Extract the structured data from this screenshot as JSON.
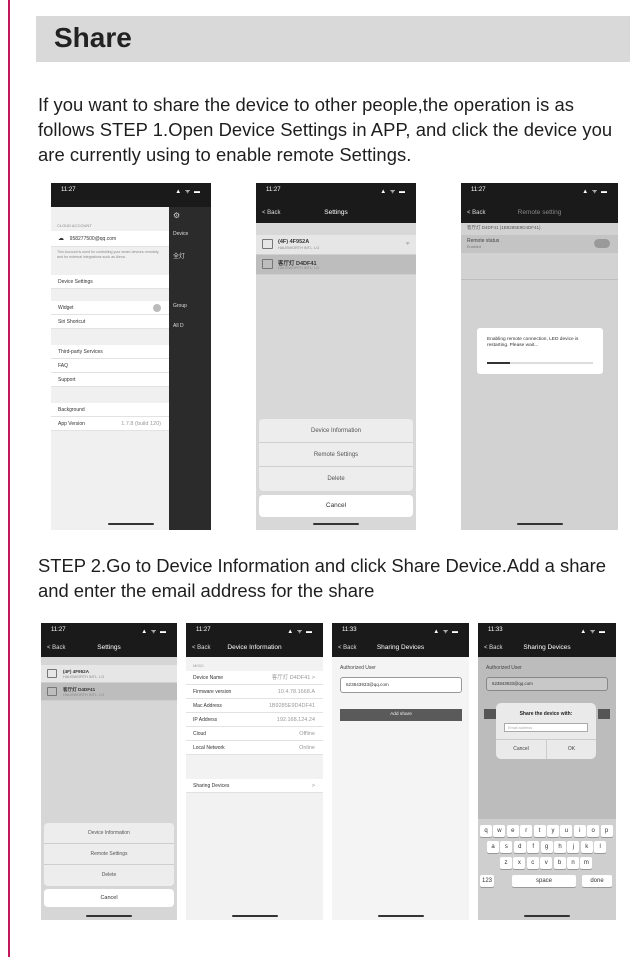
{
  "page": {
    "title": "Share",
    "intro": "If you want to share the device to other people,the operation is as follows STEP 1.Open Device Settings in APP, and click the device you are currently using to enable remote Settings.",
    "step2": "STEP 2.Go to Device Information and click Share Device.Add a share and enter the email address for the share"
  },
  "status_time": "11:27",
  "status_time_b": "11:33",
  "status_icons": "▲ ᯤ ▬",
  "phone1": {
    "account_label": "CLOUD ACCOUNT",
    "email": "958277500@qq.com",
    "note": "This Account is used for controlling your smart devices remotely, and for external integrations such as Alexa.",
    "device_settings": "Device Settings",
    "widget": "Widget",
    "siri": "Siri Shortcut",
    "third_party": "Third-party Services",
    "faq": "FAQ",
    "support": "Support",
    "background": "Background",
    "app_version_label": "App Version",
    "app_version_value": "1.7.8 (build 120)",
    "side_device": "Device",
    "side_group": "Group",
    "side_all": "All D",
    "side_item": "全灯"
  },
  "settings_screen": {
    "title": "Settings",
    "back": "< Back",
    "device1_name": "(4F) 4F952A",
    "device1_sub": "HAUSWORTH INTL. LG",
    "device2_name": "客厅灯 D4DF41",
    "device2_sub": "HAUSWORTH INTL. LG",
    "sheet_device_info": "Device Information",
    "sheet_remote": "Remote Settings",
    "sheet_delete": "Delete",
    "cancel": "Cancel"
  },
  "phone3": {
    "title": "Remote setting",
    "header_device": "客厅灯 D4DF41 (1B9285E9D4DF41)",
    "remote_label": "Remote status",
    "remote_sub": "Enabled",
    "dialog": "Enabling remote connection, LED device is restarting. Please wait..."
  },
  "device_info": {
    "title": "Device Information",
    "back": "< Back",
    "section": "MIGO",
    "rows": [
      {
        "label": "Device Name",
        "value": "客厅灯 D4DF41 >"
      },
      {
        "label": "Firmware version",
        "value": "10.4.78.1668.A"
      },
      {
        "label": "Mac Address",
        "value": "1B9285E9D4DF41"
      },
      {
        "label": "IP Address",
        "value": "192.168.124.24"
      },
      {
        "label": "Cloud",
        "value": "Offline"
      },
      {
        "label": "Local Network",
        "value": "Online"
      }
    ],
    "sharing": "Sharing Devices",
    "sharing_arrow": ">"
  },
  "sharing": {
    "title": "Sharing Devices",
    "back": "< Back",
    "authorized": "Authorized User",
    "user_email": "623843933@qq.com",
    "add_share": "Add share"
  },
  "share_dialog": {
    "title": "Share the device with:",
    "placeholder": "Email address",
    "cancel": "Cancel",
    "ok": "OK",
    "keys_row1": [
      "q",
      "w",
      "e",
      "r",
      "t",
      "y",
      "u",
      "i",
      "o",
      "p"
    ],
    "keys_row2": [
      "a",
      "s",
      "d",
      "f",
      "g",
      "h",
      "j",
      "k",
      "l"
    ],
    "keys_row3": [
      "z",
      "x",
      "c",
      "v",
      "b",
      "n",
      "m"
    ],
    "key_123": "123",
    "key_space": "space",
    "key_done": "done"
  },
  "colors": {
    "accent": "#c2185b",
    "header_bg": "#d9d9d9",
    "dark_bar": "#1a1a1a"
  }
}
